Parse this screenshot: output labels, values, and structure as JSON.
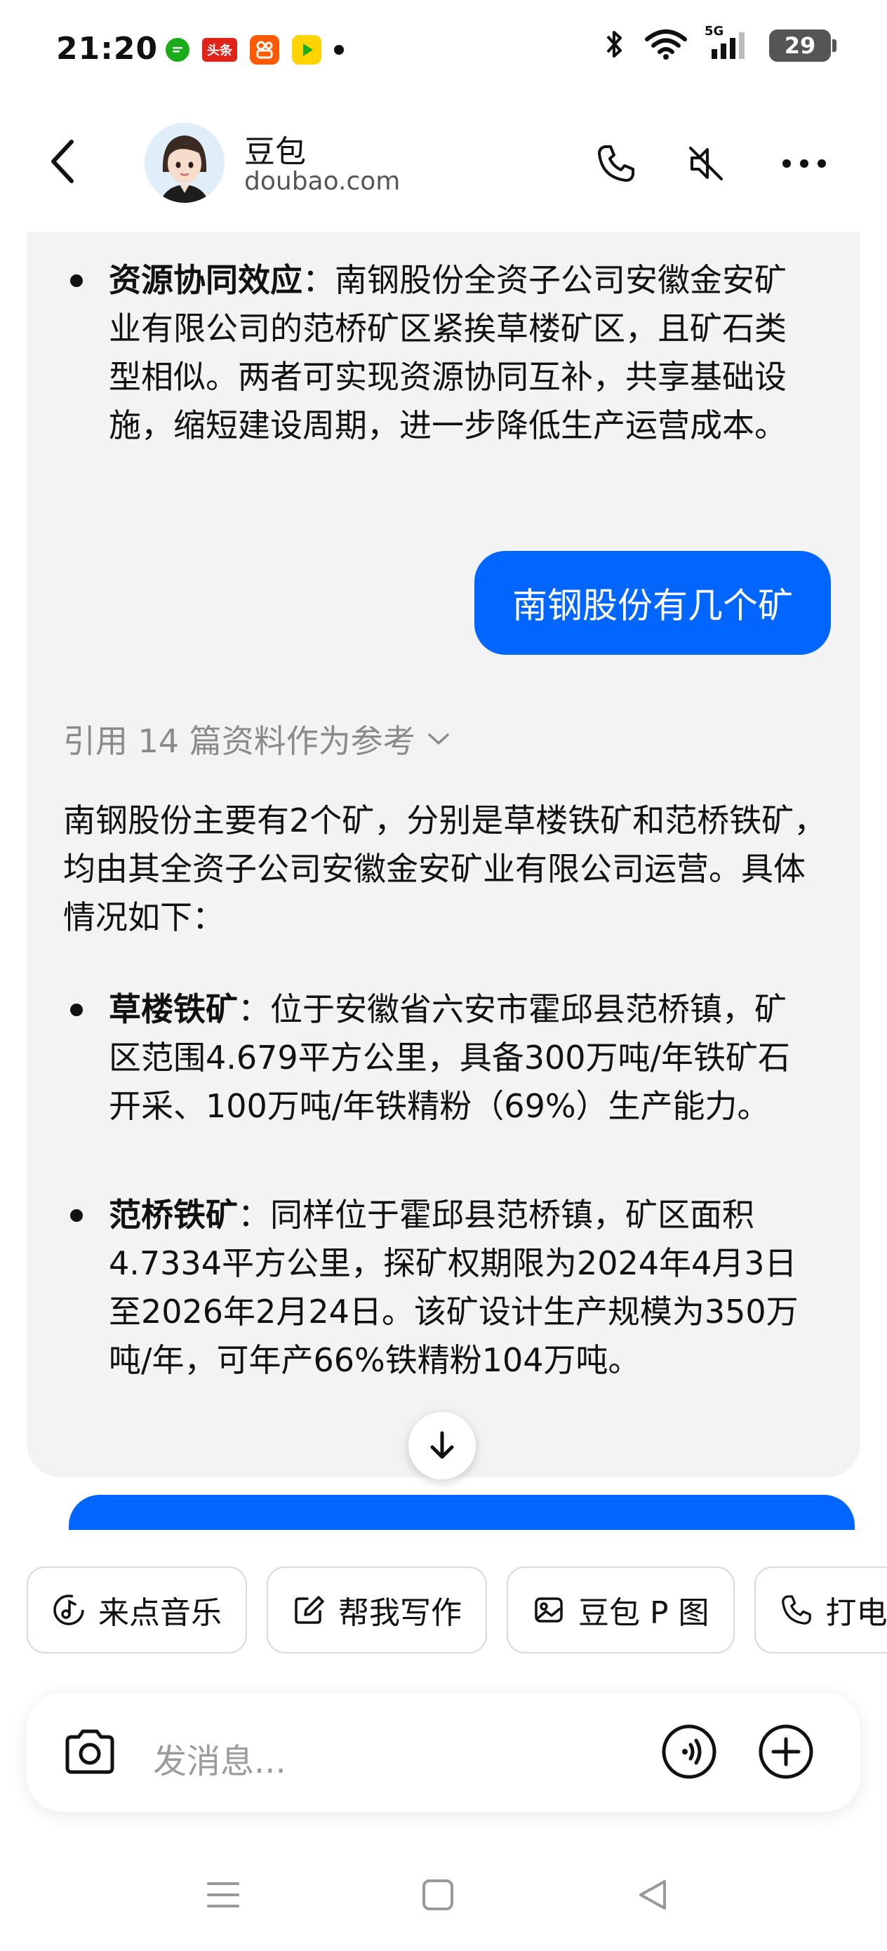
{
  "status_bar": {
    "time": "21:20",
    "toutiao_label": "头条",
    "network": "5G",
    "battery": "29"
  },
  "header": {
    "bot_name": "豆包",
    "bot_domain": "doubao.com"
  },
  "chat": {
    "prev_answer_bullet": {
      "title": "资源协同效应",
      "text": "：南钢股份全资子公司安徽金安矿业有限公司的范桥矿区紧挨草楼矿区，且矿石类型相似。两者可实现资源协同互补，共享基础设施，缩短建设周期，进一步降低生产运营成本。"
    },
    "user_message": "南钢股份有几个矿",
    "answer": {
      "reference": "引用 14 篇资料作为参考",
      "intro": "南钢股份主要有2个矿，分别是草楼铁矿和范桥铁矿，均由其全资子公司安徽金安矿业有限公司运营。具体情况如下：",
      "bullets": [
        {
          "title": "草楼铁矿",
          "text": "：位于安徽省六安市霍邱县范桥镇，矿区范围4.679平方公里，具备300万吨/年铁矿石开采、100万吨/年铁精粉（69%）生产能力。"
        },
        {
          "title": "范桥铁矿",
          "text": "：同样位于霍邱县范桥镇，矿区面积4.7334平方公里，探矿权期限为2024年4月3日至2026年2月24日。该矿设计生产规模为350万吨/年，可年产66%铁精粉104万吨。"
        }
      ]
    }
  },
  "chips": [
    {
      "label": "来点音乐",
      "icon": "music-icon"
    },
    {
      "label": "帮我写作",
      "icon": "edit-icon"
    },
    {
      "label": "豆包 P 图",
      "icon": "image-edit-icon"
    },
    {
      "label": "打电",
      "icon": "phone-icon"
    }
  ],
  "input": {
    "placeholder": "发消息..."
  },
  "colors": {
    "accent": "#0066ff",
    "bubble_bg": "#f3f3f3"
  }
}
